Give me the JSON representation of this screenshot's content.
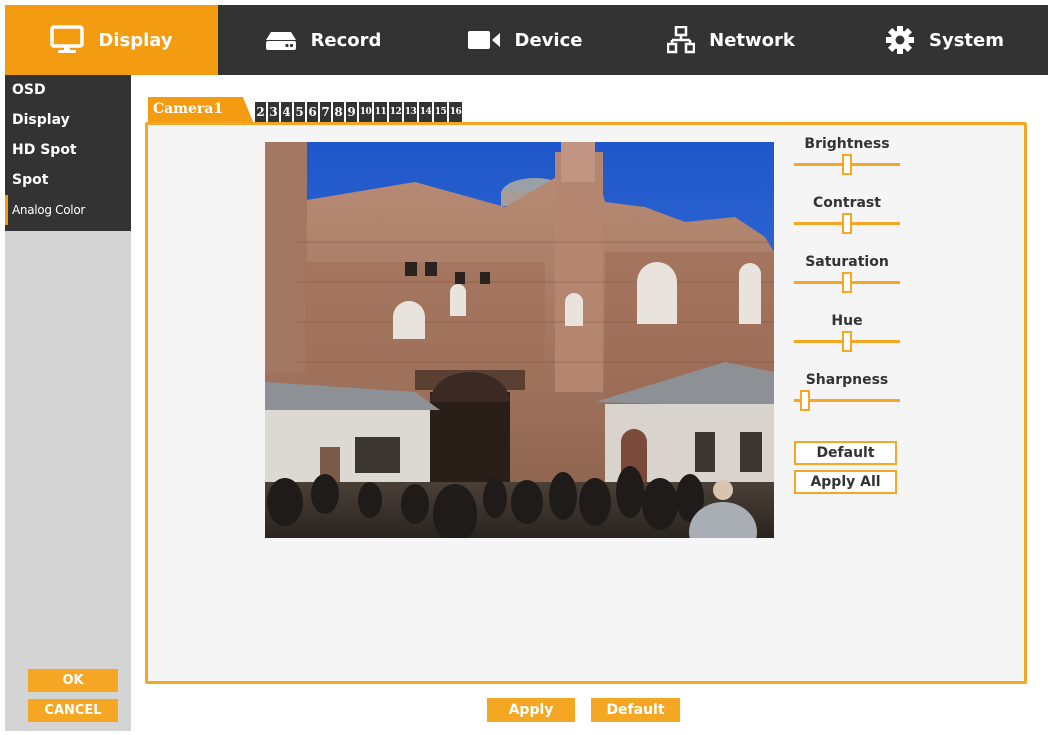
{
  "top_nav": [
    {
      "label": "Display",
      "icon": "monitor-icon",
      "active": true
    },
    {
      "label": "Record",
      "icon": "hard-drive-icon",
      "active": false
    },
    {
      "label": "Device",
      "icon": "video-camera-icon",
      "active": false
    },
    {
      "label": "Network",
      "icon": "network-icon",
      "active": false
    },
    {
      "label": "System",
      "icon": "gear-icon",
      "active": false
    }
  ],
  "sidebar": {
    "items": [
      {
        "label": "OSD"
      },
      {
        "label": "Display"
      },
      {
        "label": "HD Spot"
      },
      {
        "label": "Spot"
      },
      {
        "label": "Analog Color",
        "active": true
      }
    ],
    "ok_label": "OK",
    "cancel_label": "CANCEL"
  },
  "camera_tabs": [
    "Camera1",
    "2",
    "3",
    "4",
    "5",
    "6",
    "7",
    "8",
    "9",
    "10",
    "11",
    "12",
    "13",
    "14",
    "15",
    "16"
  ],
  "adjustments": [
    {
      "label": "Brightness",
      "value": 0.5
    },
    {
      "label": "Contrast",
      "value": 0.5
    },
    {
      "label": "Saturation",
      "value": 0.5
    },
    {
      "label": "Hue",
      "value": 0.5
    },
    {
      "label": "Sharpness",
      "value": 0.1
    }
  ],
  "panel_buttons": {
    "default_label": "Default",
    "apply_all_label": "Apply All"
  },
  "footer": {
    "apply_label": "Apply",
    "default_label": "Default"
  },
  "colors": {
    "accent": "#f39c12",
    "dark_bar": "#333333",
    "panel_bg": "#f5f5f5"
  }
}
